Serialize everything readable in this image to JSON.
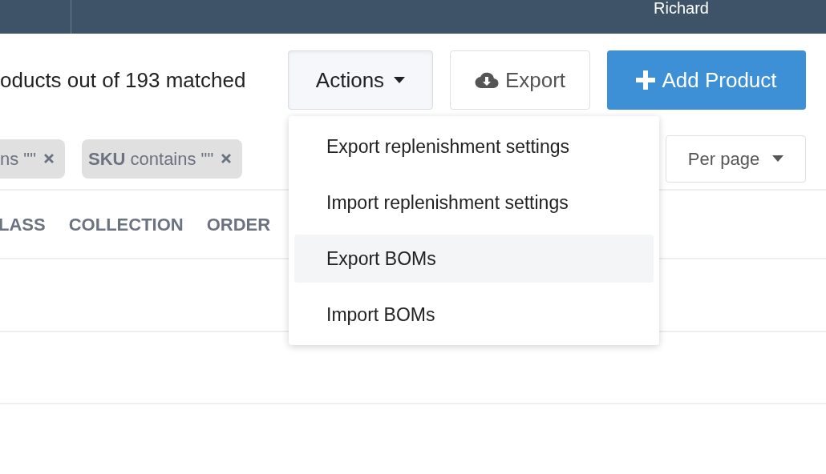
{
  "header": {
    "user_name": "Richard"
  },
  "summary": "oducts out of 193 matched",
  "actions_button": {
    "label": "Actions",
    "expanded": true
  },
  "export_button": {
    "label": "Export"
  },
  "add_button": {
    "label": "Add Product"
  },
  "filters": [
    {
      "rest": "ns \"\""
    },
    {
      "field": "SKU",
      "rest": "contains \"\""
    }
  ],
  "per_page": {
    "label": "Per page"
  },
  "columns": [
    "LASS",
    "COLLECTION",
    "ORDER"
  ],
  "actions_menu": [
    {
      "label": "Export replenishment settings",
      "selected": false
    },
    {
      "label": "Import replenishment settings",
      "selected": false
    },
    {
      "label": "Export BOMs",
      "selected": true
    },
    {
      "label": "Import BOMs",
      "selected": false
    }
  ]
}
